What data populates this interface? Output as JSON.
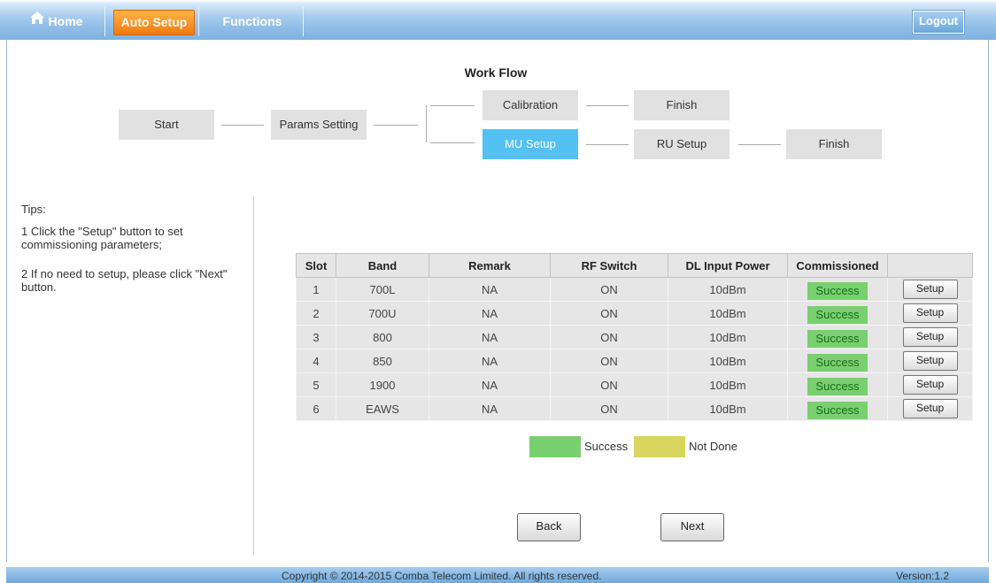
{
  "nav": {
    "home_label": "Home",
    "auto_setup_label": "Auto Setup",
    "functions_label": "Functions",
    "logout_label": "Logout"
  },
  "workflow": {
    "title": "Work Flow",
    "steps": {
      "start": "Start",
      "params": "Params Setting",
      "calibration": "Calibration",
      "finish_top": "Finish",
      "mu_setup": "MU Setup",
      "ru_setup": "RU Setup",
      "finish_bottom": "Finish"
    },
    "active_step": "MU Setup"
  },
  "tips": {
    "title": "Tips:",
    "items": [
      "1 Click the \"Setup\" button to set commissioning parameters;",
      "2 If no need to setup, please click \"Next\" button."
    ]
  },
  "table": {
    "headers": [
      "Slot",
      "Band",
      "Remark",
      "RF Switch",
      "DL Input Power",
      "Commissioned",
      ""
    ],
    "rows": [
      {
        "slot": "1",
        "band": "700L",
        "remark": "NA",
        "rf_switch": "ON",
        "dl_power": "10dBm",
        "status": "Success",
        "action": "Setup"
      },
      {
        "slot": "2",
        "band": "700U",
        "remark": "NA",
        "rf_switch": "ON",
        "dl_power": "10dBm",
        "status": "Success",
        "action": "Setup"
      },
      {
        "slot": "3",
        "band": "800",
        "remark": "NA",
        "rf_switch": "ON",
        "dl_power": "10dBm",
        "status": "Success",
        "action": "Setup"
      },
      {
        "slot": "4",
        "band": "850",
        "remark": "NA",
        "rf_switch": "ON",
        "dl_power": "10dBm",
        "status": "Success",
        "action": "Setup"
      },
      {
        "slot": "5",
        "band": "1900",
        "remark": "NA",
        "rf_switch": "ON",
        "dl_power": "10dBm",
        "status": "Success",
        "action": "Setup"
      },
      {
        "slot": "6",
        "band": "EAWS",
        "remark": "NA",
        "rf_switch": "ON",
        "dl_power": "10dBm",
        "status": "Success",
        "action": "Setup"
      }
    ]
  },
  "legend": {
    "success_label": "Success",
    "not_done_label": "Not Done"
  },
  "buttons": {
    "back": "Back",
    "next": "Next"
  },
  "footer": {
    "copyright": "Copyright © 2014-2015 Comba Telecom Limited. All rights reserved.",
    "version": "Version:1.2"
  },
  "colors": {
    "nav_bar": "#8dbce6",
    "active_tab": "#f07a10",
    "active_step": "#53c1f1",
    "step_inactive": "#e1e1e1",
    "success": "#78d06f",
    "not_done": "#d8d65e"
  }
}
